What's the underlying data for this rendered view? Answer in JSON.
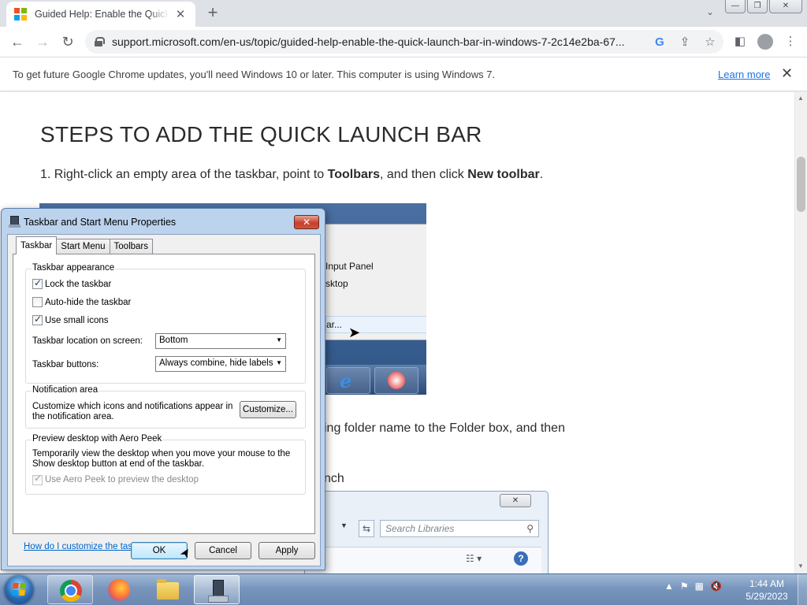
{
  "browser": {
    "tab_title": "Guided Help: Enable the Quick Launch Bar",
    "tab_close": "✕",
    "new_tab": "+",
    "tab_search": "⌄",
    "win_minimize": "—",
    "win_restore": "❐",
    "win_close": "✕",
    "back": "←",
    "forward": "→",
    "reload": "↻",
    "url": "support.microsoft.com/en-us/topic/guided-help-enable-the-quick-launch-bar-in-windows-7-2c14e2ba-67...",
    "google_icon": "G",
    "share_icon": "⇪",
    "bookmark_icon": "☆",
    "sidepanel_icon": "◧",
    "menu_icon": "⋮"
  },
  "infobar": {
    "message": "To get future Google Chrome updates, you'll need Windows 10 or later. This computer is using Windows 7.",
    "link": "Learn more",
    "close": "✕"
  },
  "article": {
    "heading": "STEPS TO ADD THE QUICK LAUNCH BAR",
    "step1_prefix": "1. Right-click an empty area of the taskbar, point to ",
    "step1_bold1": "Toolbars",
    "step1_middle": ", and then click ",
    "step1_bold2": "New toolbar",
    "step1_suffix": ".",
    "menu_items": [
      "Input Panel",
      "sktop",
      "ar..."
    ],
    "step2_fragment": "ing folder name to the Folder box, and then",
    "step3_fragment": "nch",
    "shot2_close": "✕",
    "shot2_search_placeholder": "Search Libraries",
    "shot2_help": "?"
  },
  "dialog": {
    "title": "Taskbar and Start Menu Properties",
    "close": "✕",
    "tabs": [
      "Taskbar",
      "Start Menu",
      "Toolbars"
    ],
    "group_appearance": "Taskbar appearance",
    "lock_taskbar": "Lock the taskbar",
    "auto_hide": "Auto-hide the taskbar",
    "small_icons": "Use small icons",
    "location_label": "Taskbar location on screen:",
    "location_value": "Bottom",
    "buttons_label": "Taskbar buttons:",
    "buttons_value": "Always combine, hide labels",
    "group_notification": "Notification area",
    "notification_desc": "Customize which icons and notifications appear in the notification area.",
    "customize_button": "Customize...",
    "group_aero": "Preview desktop with Aero Peek",
    "aero_desc": "Temporarily view the desktop when you move your mouse to the Show desktop button at end of the taskbar.",
    "aero_checkbox": "Use Aero Peek to preview the desktop",
    "help_link": "How do I customize the taskbar?",
    "ok": "OK",
    "cancel": "Cancel",
    "apply": "Apply"
  },
  "taskbar": {
    "tray_arrow": "▲",
    "time": "1:44 AM",
    "date": "5/29/2023"
  },
  "colors": {
    "ms_red": "#f25022",
    "ms_green": "#7fba00",
    "ms_blue": "#00a4ef",
    "ms_yellow": "#ffb900"
  }
}
